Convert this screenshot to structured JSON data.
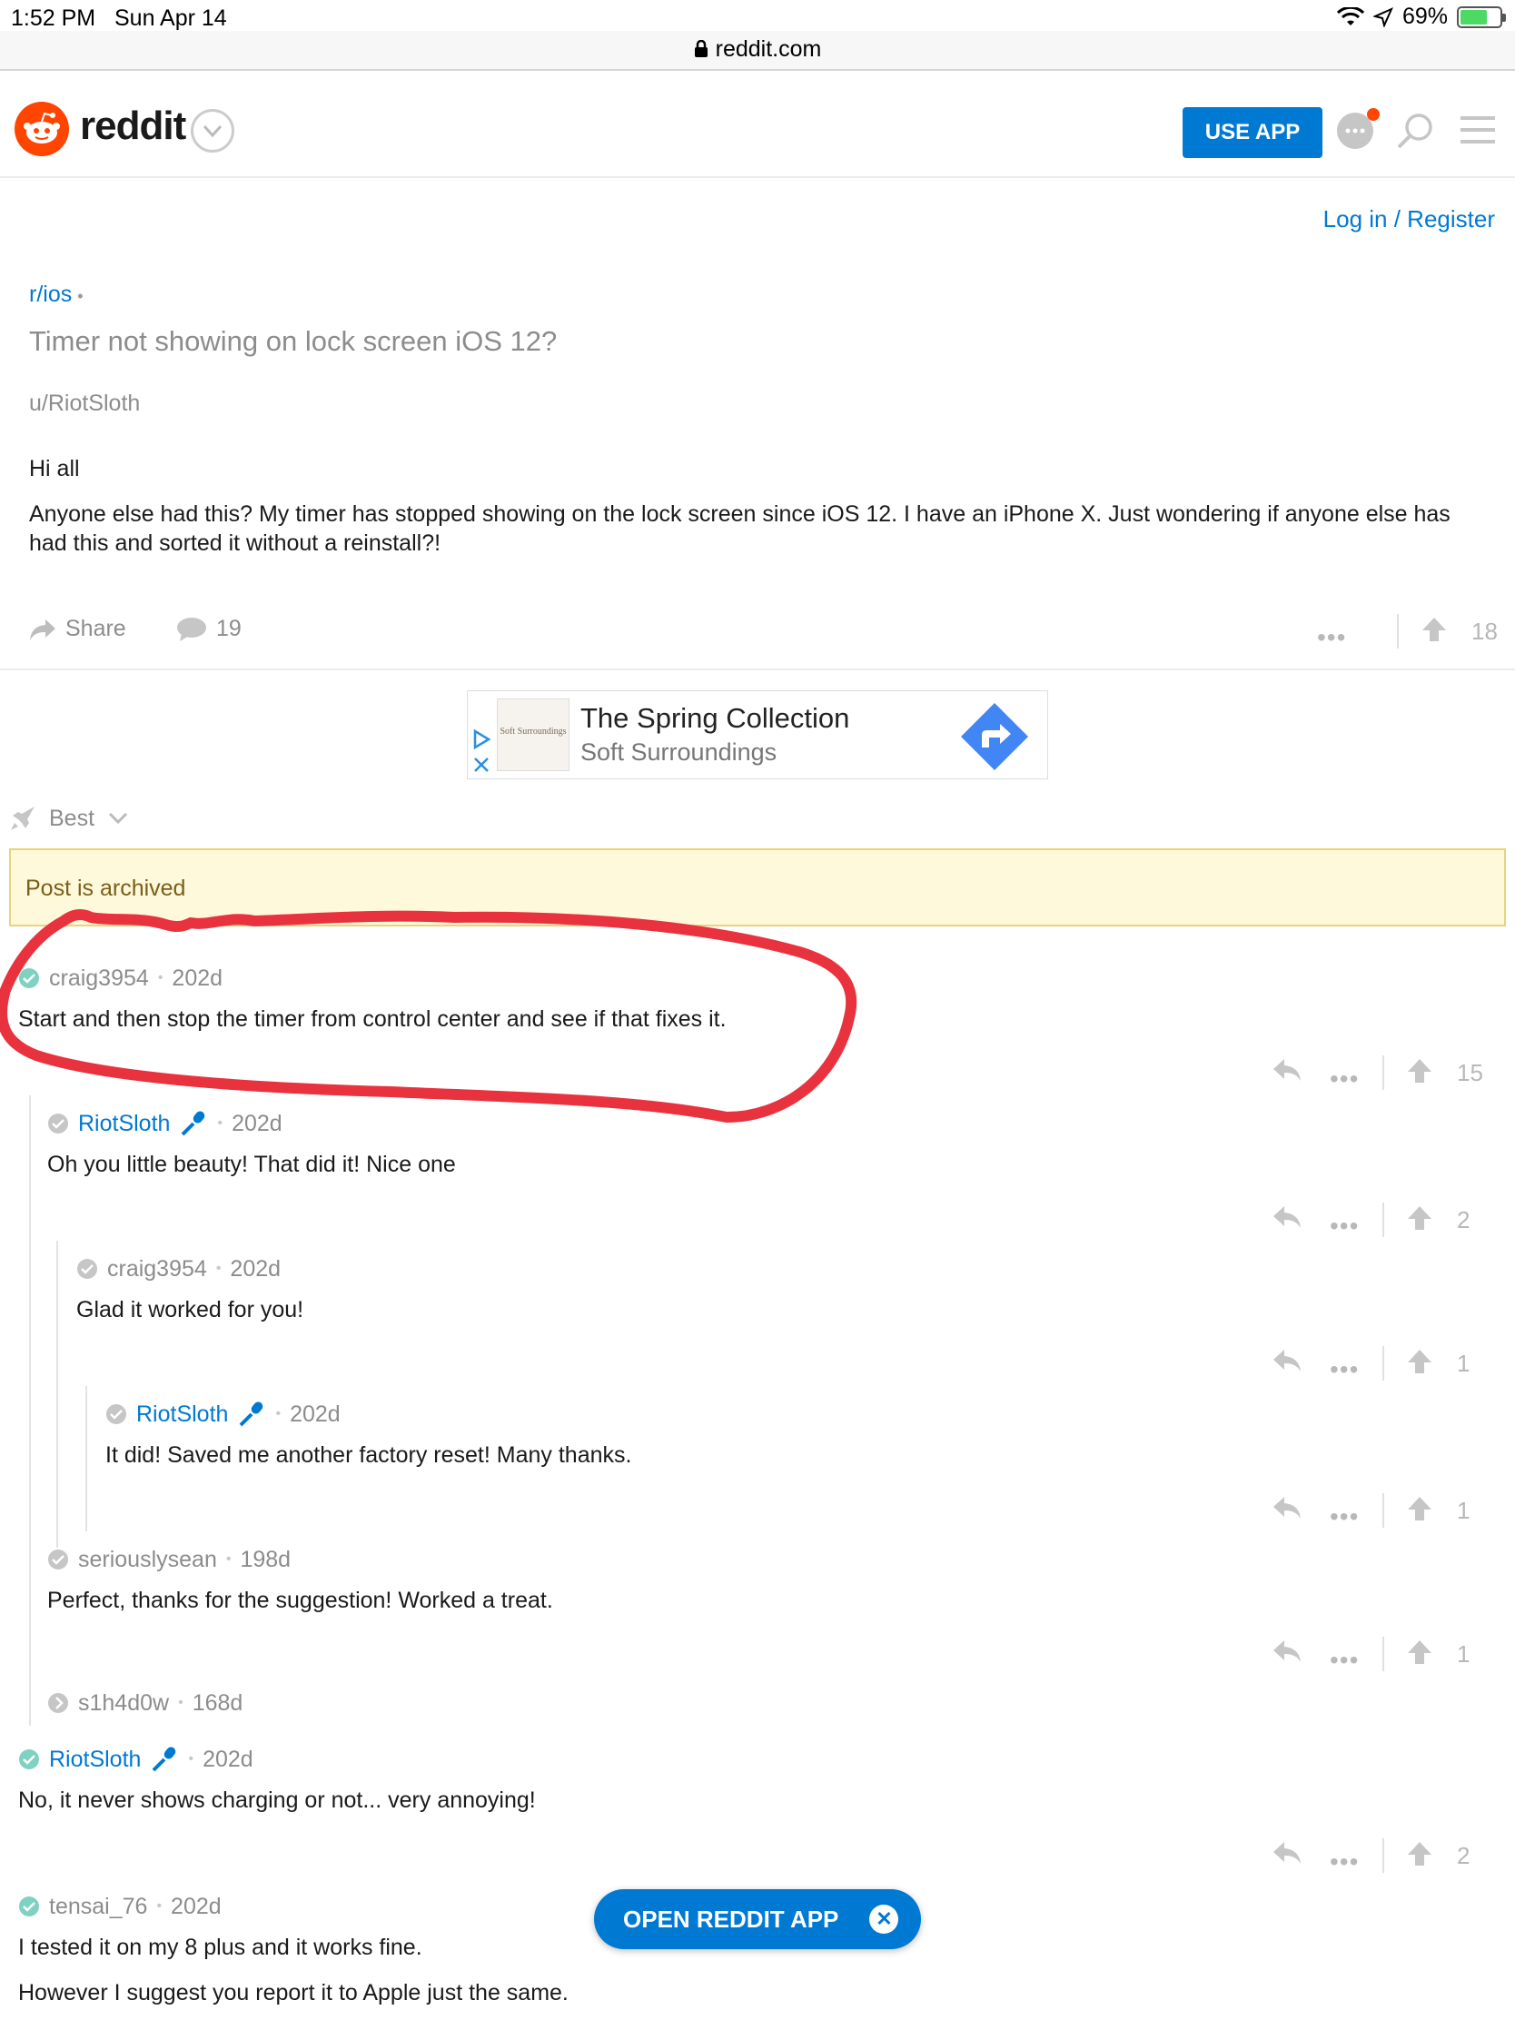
{
  "status_bar": {
    "time": "1:52 PM",
    "date": "Sun Apr 14",
    "battery": "69%"
  },
  "browser": {
    "url": "reddit.com"
  },
  "header": {
    "wordmark": "reddit",
    "use_app_label": "USE APP",
    "accent": "#0079d3",
    "brand": "#ff4500"
  },
  "auth": {
    "login_label": "Log in / Register"
  },
  "post": {
    "subreddit": "r/ios",
    "title": "Timer not showing on lock screen iOS 12?",
    "author": "u/RiotSloth",
    "body_lines": [
      "Hi all",
      "Anyone else had this? My timer has stopped showing on the lock screen since iOS 12. I have an iPhone X. Just wondering if anyone else has had this and sorted it without a reinstall?!"
    ],
    "share_label": "Share",
    "comment_count": "19",
    "score": "18"
  },
  "ad": {
    "title": "The Spring Collection",
    "advertiser": "Soft Surroundings",
    "thumb_text": "Soft Surroundings"
  },
  "sort": {
    "label": "Best"
  },
  "archived_notice": "Post is archived",
  "comments": [
    {
      "author": "craig3954",
      "age": "202d",
      "body": "Start and then stop the timer from control center and see if that fixes it.",
      "score": "15"
    },
    {
      "author": "RiotSloth",
      "age": "202d",
      "body": "Oh you little beauty! That did it! Nice one",
      "score": "2"
    },
    {
      "author": "craig3954",
      "age": "202d",
      "body": "Glad it worked for you!",
      "score": "1"
    },
    {
      "author": "RiotSloth",
      "age": "202d",
      "body": "It did! Saved me another factory reset! Many thanks.",
      "score": "1"
    },
    {
      "author": "seriouslysean",
      "age": "198d",
      "body": "Perfect, thanks for the suggestion! Worked a treat.",
      "score": "1"
    },
    {
      "author": "s1h4d0w",
      "age": "168d"
    },
    {
      "author": "RiotSloth",
      "age": "202d",
      "body": "No, it never shows charging or not... very annoying!",
      "score": "2"
    },
    {
      "author": "tensai_76",
      "age": "202d",
      "body_lines": [
        "I tested it on my 8 plus and it works fine.",
        "However I suggest you report it to Apple just the same."
      ]
    }
  ],
  "open_app_label": "OPEN REDDIT APP"
}
